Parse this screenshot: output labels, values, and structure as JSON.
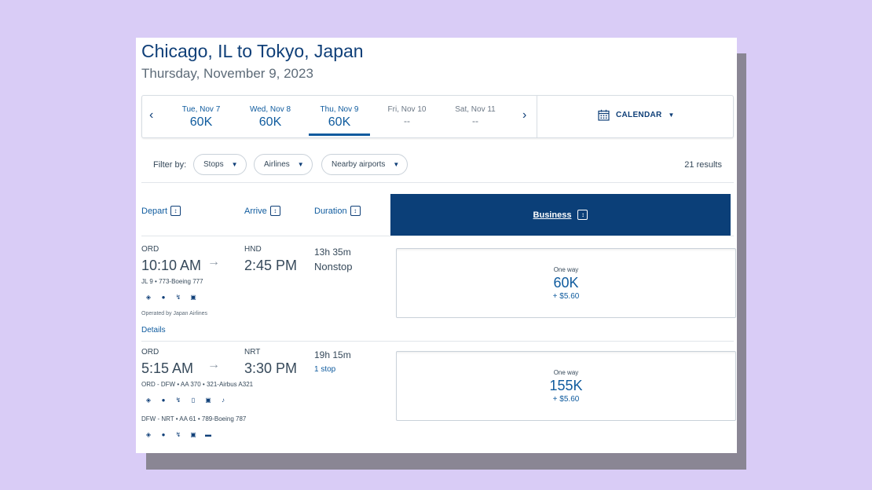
{
  "header": {
    "route_title": "Chicago, IL to Tokyo, Japan",
    "date": "Thursday, November 9, 2023"
  },
  "date_bar": {
    "prev_icon": "chevron-left-icon",
    "next_icon": "chevron-right-icon",
    "dates": [
      {
        "label": "Tue, Nov 7",
        "price": "60K",
        "selected": false
      },
      {
        "label": "Wed, Nov 8",
        "price": "60K",
        "selected": false
      },
      {
        "label": "Thu, Nov 9",
        "price": "60K",
        "selected": true
      },
      {
        "label": "Fri, Nov 10",
        "price": "--",
        "selected": false
      },
      {
        "label": "Sat, Nov 11",
        "price": "--",
        "selected": false
      }
    ],
    "calendar_label": "CALENDAR",
    "calendar_icon": "calendar-icon"
  },
  "filters": {
    "label": "Filter by:",
    "pills": [
      "Stops",
      "Airlines",
      "Nearby airports"
    ],
    "results": "21 results"
  },
  "columns": {
    "depart": "Depart",
    "arrive": "Arrive",
    "duration": "Duration",
    "cabin": "Business"
  },
  "flights": [
    {
      "depart_code": "ORD",
      "depart_time": "10:10 AM",
      "arrive_code": "HND",
      "arrive_time": "2:45 PM",
      "duration": "13h 35m",
      "stops": "Nonstop",
      "segment1": "JL 9 • 773-Boeing 777",
      "amenities1": [
        "wifi-icon",
        "seat-icon",
        "power-icon",
        "entertainment-icon"
      ],
      "operated_by": "Operated by Japan Airlines",
      "details": "Details",
      "fare_label": "One way",
      "fare_miles": "60K",
      "fare_tax": "+ $5.60"
    },
    {
      "depart_code": "ORD",
      "depart_time": "5:15 AM",
      "arrive_code": "NRT",
      "arrive_time": "3:30 PM",
      "duration": "19h 15m",
      "stops": "1 stop",
      "segment1": "ORD - DFW • AA 370 • 321-Airbus A321",
      "amenities1": [
        "wifi-icon",
        "seat-icon",
        "power-icon",
        "device-icon",
        "tv-icon",
        "music-icon"
      ],
      "segment2": "DFW - NRT • AA 61 • 789-Boeing 787",
      "amenities2": [
        "wifi-icon",
        "seat-icon",
        "power-icon",
        "entertainment-icon",
        "lieflat-icon"
      ],
      "fare_label": "One way",
      "fare_miles": "155K",
      "fare_tax": "+ $5.60"
    }
  ],
  "colors": {
    "brand_navy": "#0b3f78",
    "link_blue": "#0f5b9e",
    "background": "#d9ccf6"
  }
}
